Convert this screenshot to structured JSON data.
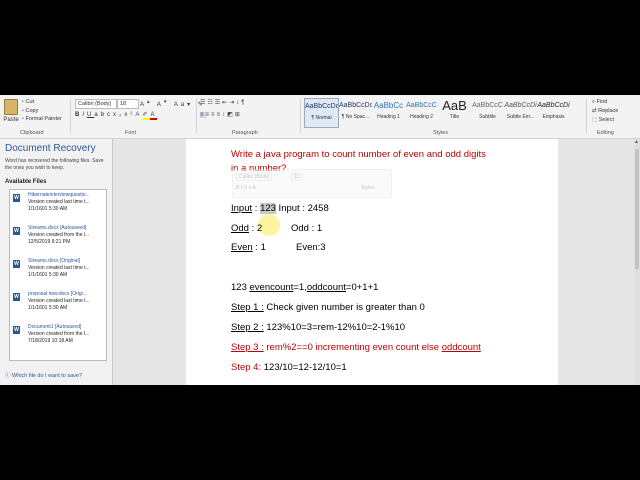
{
  "ribbon": {
    "paste": "Paste",
    "cut": "Cut",
    "copy": "Copy",
    "format_painter": "Format Painter",
    "clipboard_label": "Clipboard",
    "font_name": "Calibri (Body)",
    "font_size": "18",
    "font_label": "Font",
    "paragraph_label": "Paragraph",
    "styles_label": "Styles",
    "editing_label": "Editing",
    "styles": [
      {
        "preview": "AaBbCcDc",
        "name": "¶ Normal"
      },
      {
        "preview": "AaBbCcDc",
        "name": "¶ No Spac..."
      },
      {
        "preview": "AaBbCc",
        "name": "Heading 1"
      },
      {
        "preview": "AaBbCcC",
        "name": "Heading 2"
      },
      {
        "preview": "AaB",
        "name": "Title"
      },
      {
        "preview": "AaBbCcC",
        "name": "Subtitle"
      },
      {
        "preview": "AaBbCcDi",
        "name": "Subtle Em..."
      },
      {
        "preview": "AaBbCcDi",
        "name": "Emphasis"
      }
    ],
    "find": "Find",
    "replace": "Replace",
    "select": "Select"
  },
  "recovery": {
    "title": "Document Recovery",
    "desc": "Word has recovered the following files. Save the ones you wish to keep.",
    "available": "Available Files",
    "files": [
      {
        "name": "Hibernateinterviewquestio...",
        "line2": "Version created last time t...",
        "date": "1/1/1601 5:30 AM"
      },
      {
        "name": "Streams.docx  [Autosaved]",
        "line2": "Version created from the l...",
        "date": "12/5/2019 9:21 PM"
      },
      {
        "name": "Streams.docx  [Original]",
        "line2": "Version created last time t...",
        "date": "1/1/1601 5:30 AM"
      },
      {
        "name": "proposal new.docx  [Origi...",
        "line2": "Version created last time t...",
        "date": "1/1/1601 5:30 AM"
      },
      {
        "name": "Document1  [Autosaved]",
        "line2": "Version created from the l...",
        "date": "7/18/2019 10:18 AM"
      }
    ],
    "help": "Which file do I want to save?"
  },
  "doc": {
    "title_line1": "Write a java program to count number of even and odd digits",
    "title_line2": "in a number?",
    "input_label": "Input",
    "input1_sep": " : ",
    "input1_value": "123",
    "input2": " Input : 2458",
    "odd_label": "Odd",
    "odd1_rest": " : 2",
    "odd2": "Odd : 1",
    "even_label": "Even",
    "even1_rest": " : 1",
    "even2": "Even:3",
    "line_init_a": "123 ",
    "line_init_b": "evencount",
    "line_init_c": "=1,",
    "line_init_d": "oddcount",
    "line_init_e": "=0+1+1",
    "step1_label": "Step 1 :",
    "step1_text": " Check given number is greater than 0",
    "step2_label": "Step 2 :",
    "step2_text": " 123%10=3=rem-12%10=2-1%10",
    "step3_label": "Step 3 :",
    "step3_text": "  rem%2==0 incrementing even count else ",
    "step3_u": "oddcount",
    "step4_label": "Step 4:",
    "step4_text": " 123/10=12-12/10=1",
    "mini_font": "Calibri (Body)",
    "mini_size": "11",
    "mini_styles": "Styles"
  }
}
